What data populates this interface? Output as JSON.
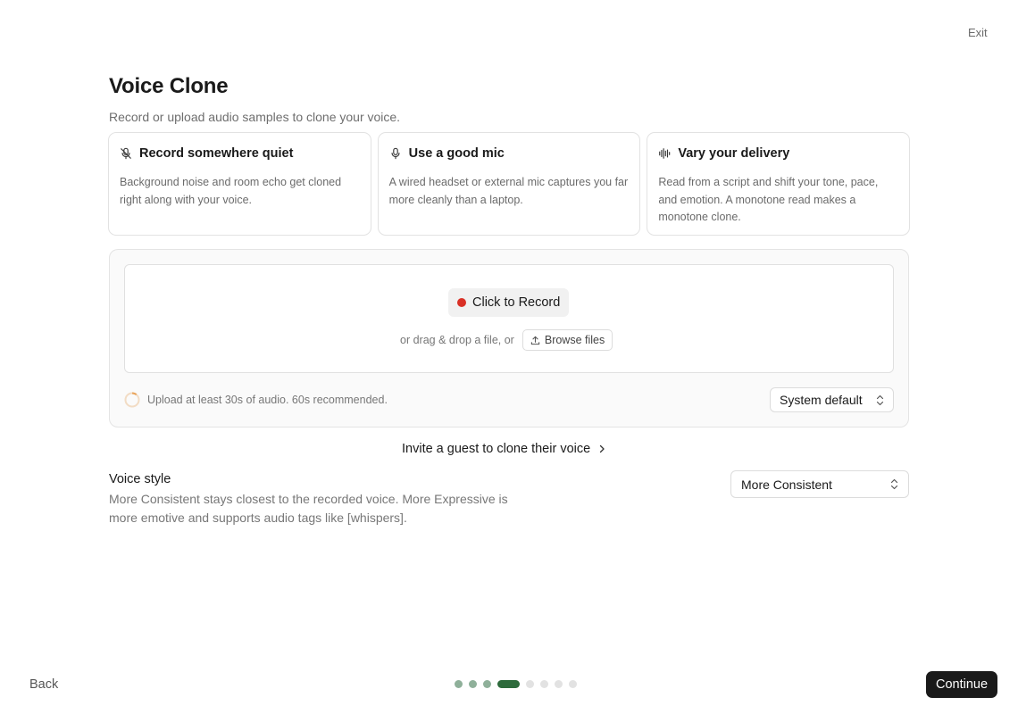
{
  "header": {
    "exit_label": "Exit"
  },
  "page": {
    "title": "Voice Clone",
    "subtitle": "Record or upload audio samples to clone your voice."
  },
  "tips": [
    {
      "icon": "mic-off-icon",
      "title": "Record somewhere quiet",
      "body": "Background noise and room echo get cloned right along with your voice."
    },
    {
      "icon": "mic-icon",
      "title": "Use a good mic",
      "body": "A wired headset or external mic captures you far more cleanly than a laptop."
    },
    {
      "icon": "audio-wave-icon",
      "title": "Vary your delivery",
      "body": "Read from a script and shift your tone, pace, and emotion. A monotone read makes a monotone clone."
    }
  ],
  "recorder": {
    "record_label": "Click to Record",
    "record_dot_color": "#d93025",
    "drop_text": "or drag & drop a file, or",
    "browse_label": "Browse files",
    "upload_hint": "Upload at least 30s of audio. 60s recommended.",
    "upload_progress": 0,
    "input_device": "System default"
  },
  "invite": {
    "label": "Invite a guest to clone their voice"
  },
  "voice_style": {
    "label": "Voice style",
    "description": "More Consistent stays closest to the recorded voice. More Expressive is more emotive and supports audio tags like [whispers].",
    "selected": "More Consistent"
  },
  "footer": {
    "back_label": "Back",
    "continue_label": "Continue",
    "steps_total": 8,
    "current_step": 4,
    "accent_color": "#2e6b3c"
  }
}
